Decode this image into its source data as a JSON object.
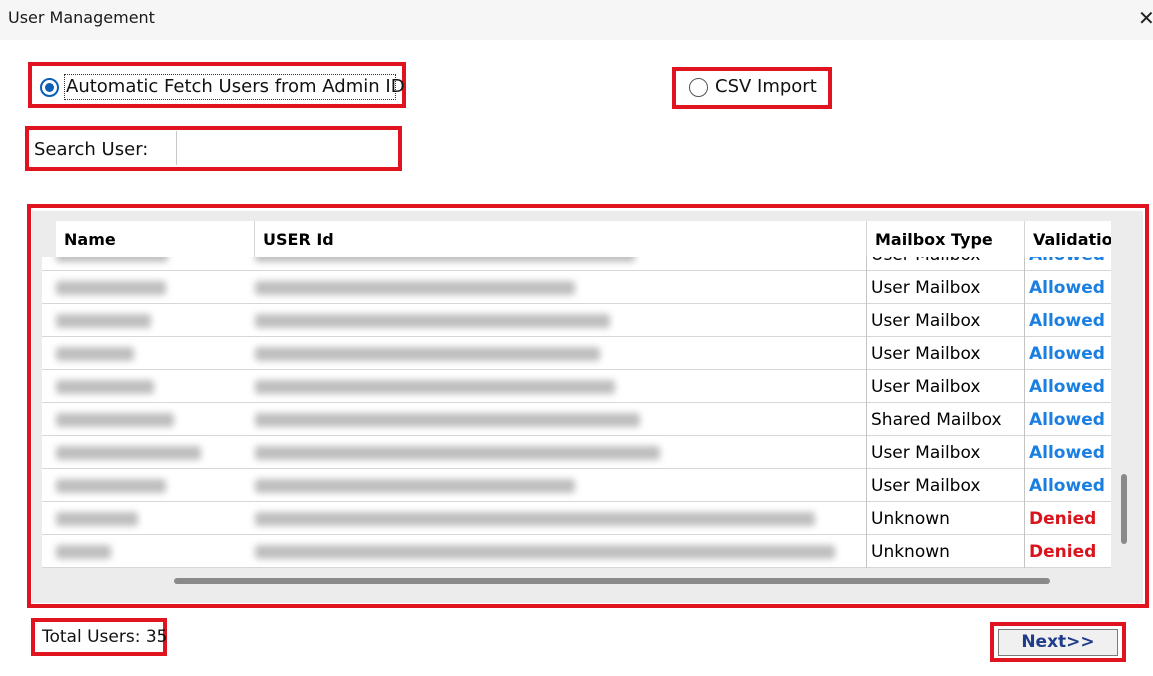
{
  "window": {
    "title": "User Management",
    "close_glyph": "✕"
  },
  "source_options": {
    "automatic": {
      "label": "Automatic Fetch Users from Admin ID",
      "selected": true
    },
    "csv": {
      "label": "CSV Import",
      "selected": false
    }
  },
  "search": {
    "label": "Search User:",
    "value": "",
    "placeholder": ""
  },
  "table": {
    "columns": [
      "Name",
      "USER Id",
      "Mailbox Type",
      "Validation"
    ],
    "rows": [
      {
        "name": "",
        "user_id": "",
        "mailbox_type": "User Mailbox",
        "validation": "Allowed"
      },
      {
        "name": "",
        "user_id": "",
        "mailbox_type": "User Mailbox",
        "validation": "Allowed"
      },
      {
        "name": "",
        "user_id": "",
        "mailbox_type": "User Mailbox",
        "validation": "Allowed"
      },
      {
        "name": "",
        "user_id": "",
        "mailbox_type": "User Mailbox",
        "validation": "Allowed"
      },
      {
        "name": "",
        "user_id": "",
        "mailbox_type": "User Mailbox",
        "validation": "Allowed"
      },
      {
        "name": "",
        "user_id": "",
        "mailbox_type": "Shared Mailbox",
        "validation": "Allowed"
      },
      {
        "name": "",
        "user_id": "",
        "mailbox_type": "User Mailbox",
        "validation": "Allowed"
      },
      {
        "name": "",
        "user_id": "",
        "mailbox_type": "User Mailbox",
        "validation": "Allowed"
      },
      {
        "name": "",
        "user_id": "",
        "mailbox_type": "Unknown",
        "validation": "Denied"
      },
      {
        "name": "",
        "user_id": "",
        "mailbox_type": "Unknown",
        "validation": "Denied"
      }
    ]
  },
  "footer": {
    "total_users": "Total Users: 35",
    "next_label": "Next>>"
  },
  "colors": {
    "highlight_border": "#e0141f",
    "allowed": "#1a7fe0",
    "denied": "#d9141c",
    "next_text": "#1f3b8a"
  },
  "icons": {
    "close": "close-icon",
    "radio_selected": "radio-selected-icon",
    "radio_unselected": "radio-unselected-icon"
  }
}
